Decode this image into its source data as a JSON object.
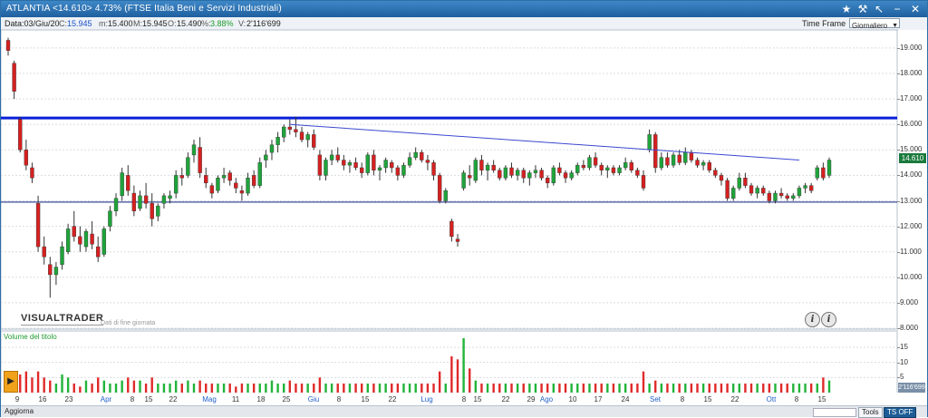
{
  "title": {
    "text": "ATLANTIA <14.610>  4.73%  (FTSE Italia Beni e Servizi Industriali)"
  },
  "infobar": {
    "data": "Data:03/Giu/20",
    "close_label": "C:",
    "close": "15.945",
    "min_label": "m:",
    "min": "15.400",
    "max_label": "M:",
    "max": "15.945",
    "open_label": "O:",
    "open": "15.490",
    "pct_label": "%:",
    "pct": "3.88%",
    "vol_label": "V:",
    "vol": "2'116'699"
  },
  "timeframe": {
    "label": "Time Frame",
    "value": "Giornaliero"
  },
  "price_axis": [
    "19.000",
    "18.000",
    "17.000",
    "16.000",
    "15.000",
    "14.000",
    "13.000",
    "12.000",
    "11.000",
    "10.000",
    "9.000",
    "8.000"
  ],
  "price_badge": "14.610",
  "volume_axis": [
    "15",
    "10",
    "5"
  ],
  "volume_badge": "2'116'699",
  "brand": "VISUALTRADER",
  "eod_note": "Dati di fine giornata",
  "volume_label": "Volume del titolo",
  "x_axis": [
    {
      "t": "9",
      "m": false
    },
    {
      "t": "16",
      "m": false
    },
    {
      "t": "23",
      "m": false
    },
    {
      "t": "Apr",
      "m": true
    },
    {
      "t": "8",
      "m": false
    },
    {
      "t": "15",
      "m": false
    },
    {
      "t": "22",
      "m": false
    },
    {
      "t": "Mag",
      "m": true
    },
    {
      "t": "11",
      "m": false
    },
    {
      "t": "18",
      "m": false
    },
    {
      "t": "25",
      "m": false
    },
    {
      "t": "Giu",
      "m": true
    },
    {
      "t": "8",
      "m": false
    },
    {
      "t": "15",
      "m": false
    },
    {
      "t": "22",
      "m": false
    },
    {
      "t": "Lug",
      "m": true
    },
    {
      "t": "8",
      "m": false
    },
    {
      "t": "15",
      "m": false
    },
    {
      "t": "22",
      "m": false
    },
    {
      "t": "29",
      "m": false
    },
    {
      "t": "Ago",
      "m": true
    },
    {
      "t": "10",
      "m": false
    },
    {
      "t": "17",
      "m": false
    },
    {
      "t": "24",
      "m": false
    },
    {
      "t": "Set",
      "m": true
    },
    {
      "t": "8",
      "m": false
    },
    {
      "t": "15",
      "m": false
    },
    {
      "t": "22",
      "m": false
    },
    {
      "t": "Ott",
      "m": true
    },
    {
      "t": "8",
      "m": false
    },
    {
      "t": "15",
      "m": false
    }
  ],
  "status": {
    "left": "Aggiorna",
    "tools": "Tools",
    "tsoff": "TS OFF"
  },
  "colors": {
    "up": "#1fa43a",
    "down": "#d62020",
    "hline": "#0a1fd6",
    "trend": "#3a48d0",
    "vol_up": "#22b43a",
    "vol_down": "#e02a2a"
  },
  "chart_data": {
    "type": "candlestick",
    "ylim": [
      8,
      19.5
    ],
    "vol_ylim": [
      0,
      18
    ],
    "hlines": [
      16.25,
      12.95
    ],
    "trendline": [
      {
        "i": 47,
        "v": 16.0
      },
      {
        "i": 132,
        "v": 14.6
      }
    ],
    "candles": [
      [
        19.3,
        19.4,
        18.7,
        18.9
      ],
      [
        18.4,
        18.5,
        17.0,
        17.3
      ],
      [
        16.2,
        16.3,
        14.9,
        15.0
      ],
      [
        15.0,
        15.4,
        14.2,
        14.4
      ],
      [
        14.3,
        14.5,
        13.7,
        13.9
      ],
      [
        12.9,
        13.2,
        11.0,
        11.2
      ],
      [
        11.2,
        11.6,
        10.5,
        10.8
      ],
      [
        10.5,
        10.8,
        9.2,
        10.1
      ],
      [
        10.1,
        10.6,
        9.7,
        10.4
      ],
      [
        10.5,
        11.4,
        10.3,
        11.2
      ],
      [
        11.0,
        12.1,
        10.9,
        11.9
      ],
      [
        12.0,
        12.6,
        11.4,
        11.6
      ],
      [
        11.6,
        12.0,
        11.0,
        11.3
      ],
      [
        11.2,
        11.9,
        11.0,
        11.8
      ],
      [
        11.7,
        12.2,
        11.1,
        11.3
      ],
      [
        11.2,
        11.6,
        10.6,
        10.8
      ],
      [
        10.9,
        12.0,
        10.8,
        11.9
      ],
      [
        12.0,
        12.8,
        11.8,
        12.6
      ],
      [
        12.6,
        13.3,
        12.4,
        13.1
      ],
      [
        13.2,
        14.3,
        13.0,
        14.1
      ],
      [
        14.0,
        14.4,
        13.2,
        13.4
      ],
      [
        13.3,
        13.6,
        12.4,
        12.6
      ],
      [
        12.7,
        13.4,
        12.6,
        13.2
      ],
      [
        13.2,
        13.7,
        12.7,
        12.9
      ],
      [
        12.9,
        13.3,
        12.0,
        12.3
      ],
      [
        12.4,
        12.9,
        12.2,
        12.8
      ],
      [
        12.9,
        13.3,
        12.7,
        13.2
      ],
      [
        13.1,
        13.4,
        12.9,
        13.2
      ],
      [
        13.3,
        14.2,
        13.1,
        14.0
      ],
      [
        14.0,
        14.3,
        13.6,
        13.9
      ],
      [
        14.0,
        14.9,
        13.9,
        14.7
      ],
      [
        14.8,
        15.4,
        14.5,
        15.2
      ],
      [
        15.1,
        15.5,
        13.9,
        14.1
      ],
      [
        14.0,
        14.3,
        13.5,
        13.7
      ],
      [
        13.6,
        13.7,
        13.1,
        13.3
      ],
      [
        13.4,
        14.0,
        13.3,
        13.9
      ],
      [
        13.9,
        14.3,
        13.7,
        14.0
      ],
      [
        14.1,
        14.2,
        13.6,
        13.8
      ],
      [
        13.7,
        13.9,
        13.3,
        13.5
      ],
      [
        13.4,
        13.6,
        13.0,
        13.3
      ],
      [
        13.3,
        14.1,
        13.2,
        13.9
      ],
      [
        14.0,
        14.2,
        13.5,
        13.6
      ],
      [
        13.6,
        14.7,
        13.5,
        14.5
      ],
      [
        14.6,
        15.0,
        14.3,
        14.8
      ],
      [
        14.9,
        15.4,
        14.6,
        15.2
      ],
      [
        15.2,
        15.7,
        14.9,
        15.5
      ],
      [
        15.5,
        16.0,
        15.3,
        15.9
      ],
      [
        15.9,
        16.2,
        15.6,
        15.8
      ],
      [
        15.8,
        16.3,
        15.5,
        15.7
      ],
      [
        15.7,
        15.9,
        15.3,
        15.4
      ],
      [
        15.4,
        15.7,
        15.1,
        15.6
      ],
      [
        15.6,
        15.8,
        15.0,
        15.1
      ],
      [
        14.8,
        15.0,
        13.8,
        14.0
      ],
      [
        14.0,
        14.7,
        13.8,
        14.6
      ],
      [
        14.6,
        15.0,
        14.4,
        14.8
      ],
      [
        14.8,
        15.1,
        14.5,
        14.6
      ],
      [
        14.6,
        14.8,
        14.2,
        14.4
      ],
      [
        14.4,
        14.6,
        14.1,
        14.5
      ],
      [
        14.5,
        14.7,
        14.2,
        14.3
      ],
      [
        14.3,
        14.5,
        13.9,
        14.1
      ],
      [
        14.1,
        14.9,
        14.0,
        14.8
      ],
      [
        14.8,
        15.0,
        14.0,
        14.2
      ],
      [
        14.2,
        14.4,
        13.8,
        14.3
      ],
      [
        14.3,
        14.7,
        14.1,
        14.6
      ],
      [
        14.5,
        14.6,
        14.1,
        14.3
      ],
      [
        14.3,
        14.4,
        13.8,
        14.0
      ],
      [
        14.0,
        14.5,
        13.9,
        14.4
      ],
      [
        14.4,
        14.9,
        14.3,
        14.7
      ],
      [
        14.7,
        15.1,
        14.6,
        14.9
      ],
      [
        14.9,
        15.0,
        14.5,
        14.6
      ],
      [
        14.6,
        14.8,
        14.2,
        14.5
      ],
      [
        14.5,
        14.6,
        13.8,
        14.0
      ],
      [
        14.0,
        14.1,
        12.9,
        13.0
      ],
      [
        13.0,
        13.5,
        12.9,
        13.4
      ],
      [
        12.2,
        12.3,
        11.4,
        11.6
      ],
      [
        11.5,
        11.7,
        11.2,
        11.4
      ],
      [
        13.5,
        14.2,
        13.4,
        14.1
      ],
      [
        14.0,
        14.4,
        13.6,
        13.9
      ],
      [
        13.8,
        14.7,
        13.7,
        14.6
      ],
      [
        14.6,
        14.8,
        14.0,
        14.2
      ],
      [
        14.2,
        14.5,
        13.8,
        14.4
      ],
      [
        14.4,
        14.6,
        14.1,
        14.2
      ],
      [
        14.2,
        14.3,
        13.8,
        13.9
      ],
      [
        13.9,
        14.4,
        13.8,
        14.3
      ],
      [
        14.3,
        14.5,
        13.9,
        14.0
      ],
      [
        14.0,
        14.3,
        13.8,
        14.2
      ],
      [
        14.2,
        14.3,
        13.7,
        13.9
      ],
      [
        13.9,
        14.2,
        13.6,
        14.1
      ],
      [
        14.1,
        14.4,
        13.9,
        14.2
      ],
      [
        14.2,
        14.3,
        13.8,
        13.9
      ],
      [
        13.9,
        14.0,
        13.5,
        13.7
      ],
      [
        13.7,
        14.4,
        13.6,
        14.3
      ],
      [
        14.3,
        14.5,
        14.0,
        14.1
      ],
      [
        14.1,
        14.2,
        13.7,
        13.9
      ],
      [
        13.9,
        14.2,
        13.8,
        14.1
      ],
      [
        14.1,
        14.5,
        14.0,
        14.4
      ],
      [
        14.4,
        14.6,
        14.2,
        14.3
      ],
      [
        14.3,
        14.8,
        14.2,
        14.7
      ],
      [
        14.7,
        14.9,
        14.3,
        14.4
      ],
      [
        14.4,
        14.5,
        14.0,
        14.2
      ],
      [
        14.2,
        14.4,
        13.9,
        14.3
      ],
      [
        14.3,
        14.4,
        14.0,
        14.1
      ],
      [
        14.1,
        14.4,
        14.0,
        14.3
      ],
      [
        14.3,
        14.7,
        14.2,
        14.5
      ],
      [
        14.5,
        14.6,
        14.1,
        14.2
      ],
      [
        14.2,
        14.3,
        13.9,
        14.0
      ],
      [
        14.0,
        14.2,
        13.4,
        13.5
      ],
      [
        15.0,
        15.8,
        14.9,
        15.6
      ],
      [
        15.6,
        15.7,
        14.1,
        14.3
      ],
      [
        14.3,
        14.9,
        14.2,
        14.7
      ],
      [
        14.7,
        14.9,
        14.3,
        14.4
      ],
      [
        14.4,
        14.9,
        14.3,
        14.8
      ],
      [
        14.8,
        15.0,
        14.4,
        14.5
      ],
      [
        14.5,
        15.1,
        14.4,
        14.9
      ],
      [
        14.9,
        15.0,
        14.5,
        14.6
      ],
      [
        14.6,
        14.7,
        14.3,
        14.4
      ],
      [
        14.4,
        14.6,
        14.2,
        14.5
      ],
      [
        14.5,
        14.6,
        14.1,
        14.2
      ],
      [
        14.2,
        14.3,
        13.9,
        14.0
      ],
      [
        14.0,
        14.1,
        13.6,
        13.8
      ],
      [
        13.8,
        13.9,
        13.0,
        13.1
      ],
      [
        13.1,
        13.6,
        13.0,
        13.5
      ],
      [
        13.5,
        14.1,
        13.4,
        13.9
      ],
      [
        13.9,
        14.1,
        13.5,
        13.6
      ],
      [
        13.6,
        13.7,
        13.2,
        13.3
      ],
      [
        13.3,
        13.6,
        13.1,
        13.5
      ],
      [
        13.5,
        13.6,
        13.2,
        13.3
      ],
      [
        13.3,
        13.4,
        12.9,
        13.0
      ],
      [
        13.0,
        13.4,
        12.9,
        13.3
      ],
      [
        13.3,
        13.5,
        13.1,
        13.2
      ],
      [
        13.2,
        13.3,
        13.0,
        13.1
      ],
      [
        13.1,
        13.3,
        13.0,
        13.2
      ],
      [
        13.2,
        13.6,
        13.1,
        13.5
      ],
      [
        13.5,
        13.7,
        13.3,
        13.6
      ],
      [
        13.6,
        13.7,
        13.3,
        13.4
      ],
      [
        13.9,
        14.4,
        13.8,
        14.3
      ],
      [
        14.3,
        14.5,
        13.8,
        13.9
      ],
      [
        14.0,
        14.7,
        13.9,
        14.6
      ]
    ],
    "volume": [
      4,
      3,
      6,
      7,
      5,
      7,
      5,
      4,
      3,
      6,
      5,
      3,
      2,
      4,
      3,
      5,
      4,
      3,
      3,
      4,
      5,
      4,
      4,
      3,
      5,
      3,
      3,
      3,
      4,
      3,
      4,
      3,
      4,
      3,
      3,
      3,
      3,
      3,
      2,
      3,
      3,
      3,
      3,
      3,
      4,
      3,
      3,
      4,
      3,
      3,
      3,
      3,
      5,
      3,
      3,
      3,
      3,
      3,
      3,
      3,
      3,
      3,
      3,
      3,
      3,
      3,
      3,
      3,
      3,
      3,
      3,
      3,
      7,
      3,
      12,
      11,
      18,
      8,
      4,
      3,
      3,
      3,
      3,
      3,
      3,
      3,
      3,
      3,
      3,
      3,
      3,
      3,
      3,
      3,
      3,
      3,
      3,
      3,
      3,
      3,
      3,
      3,
      3,
      3,
      3,
      3,
      7,
      3,
      4,
      3,
      3,
      3,
      3,
      3,
      3,
      3,
      3,
      3,
      3,
      3,
      3,
      3,
      3,
      3,
      3,
      3,
      3,
      3,
      3,
      3,
      3,
      3,
      3,
      3,
      3,
      3,
      5,
      4,
      3
    ]
  }
}
